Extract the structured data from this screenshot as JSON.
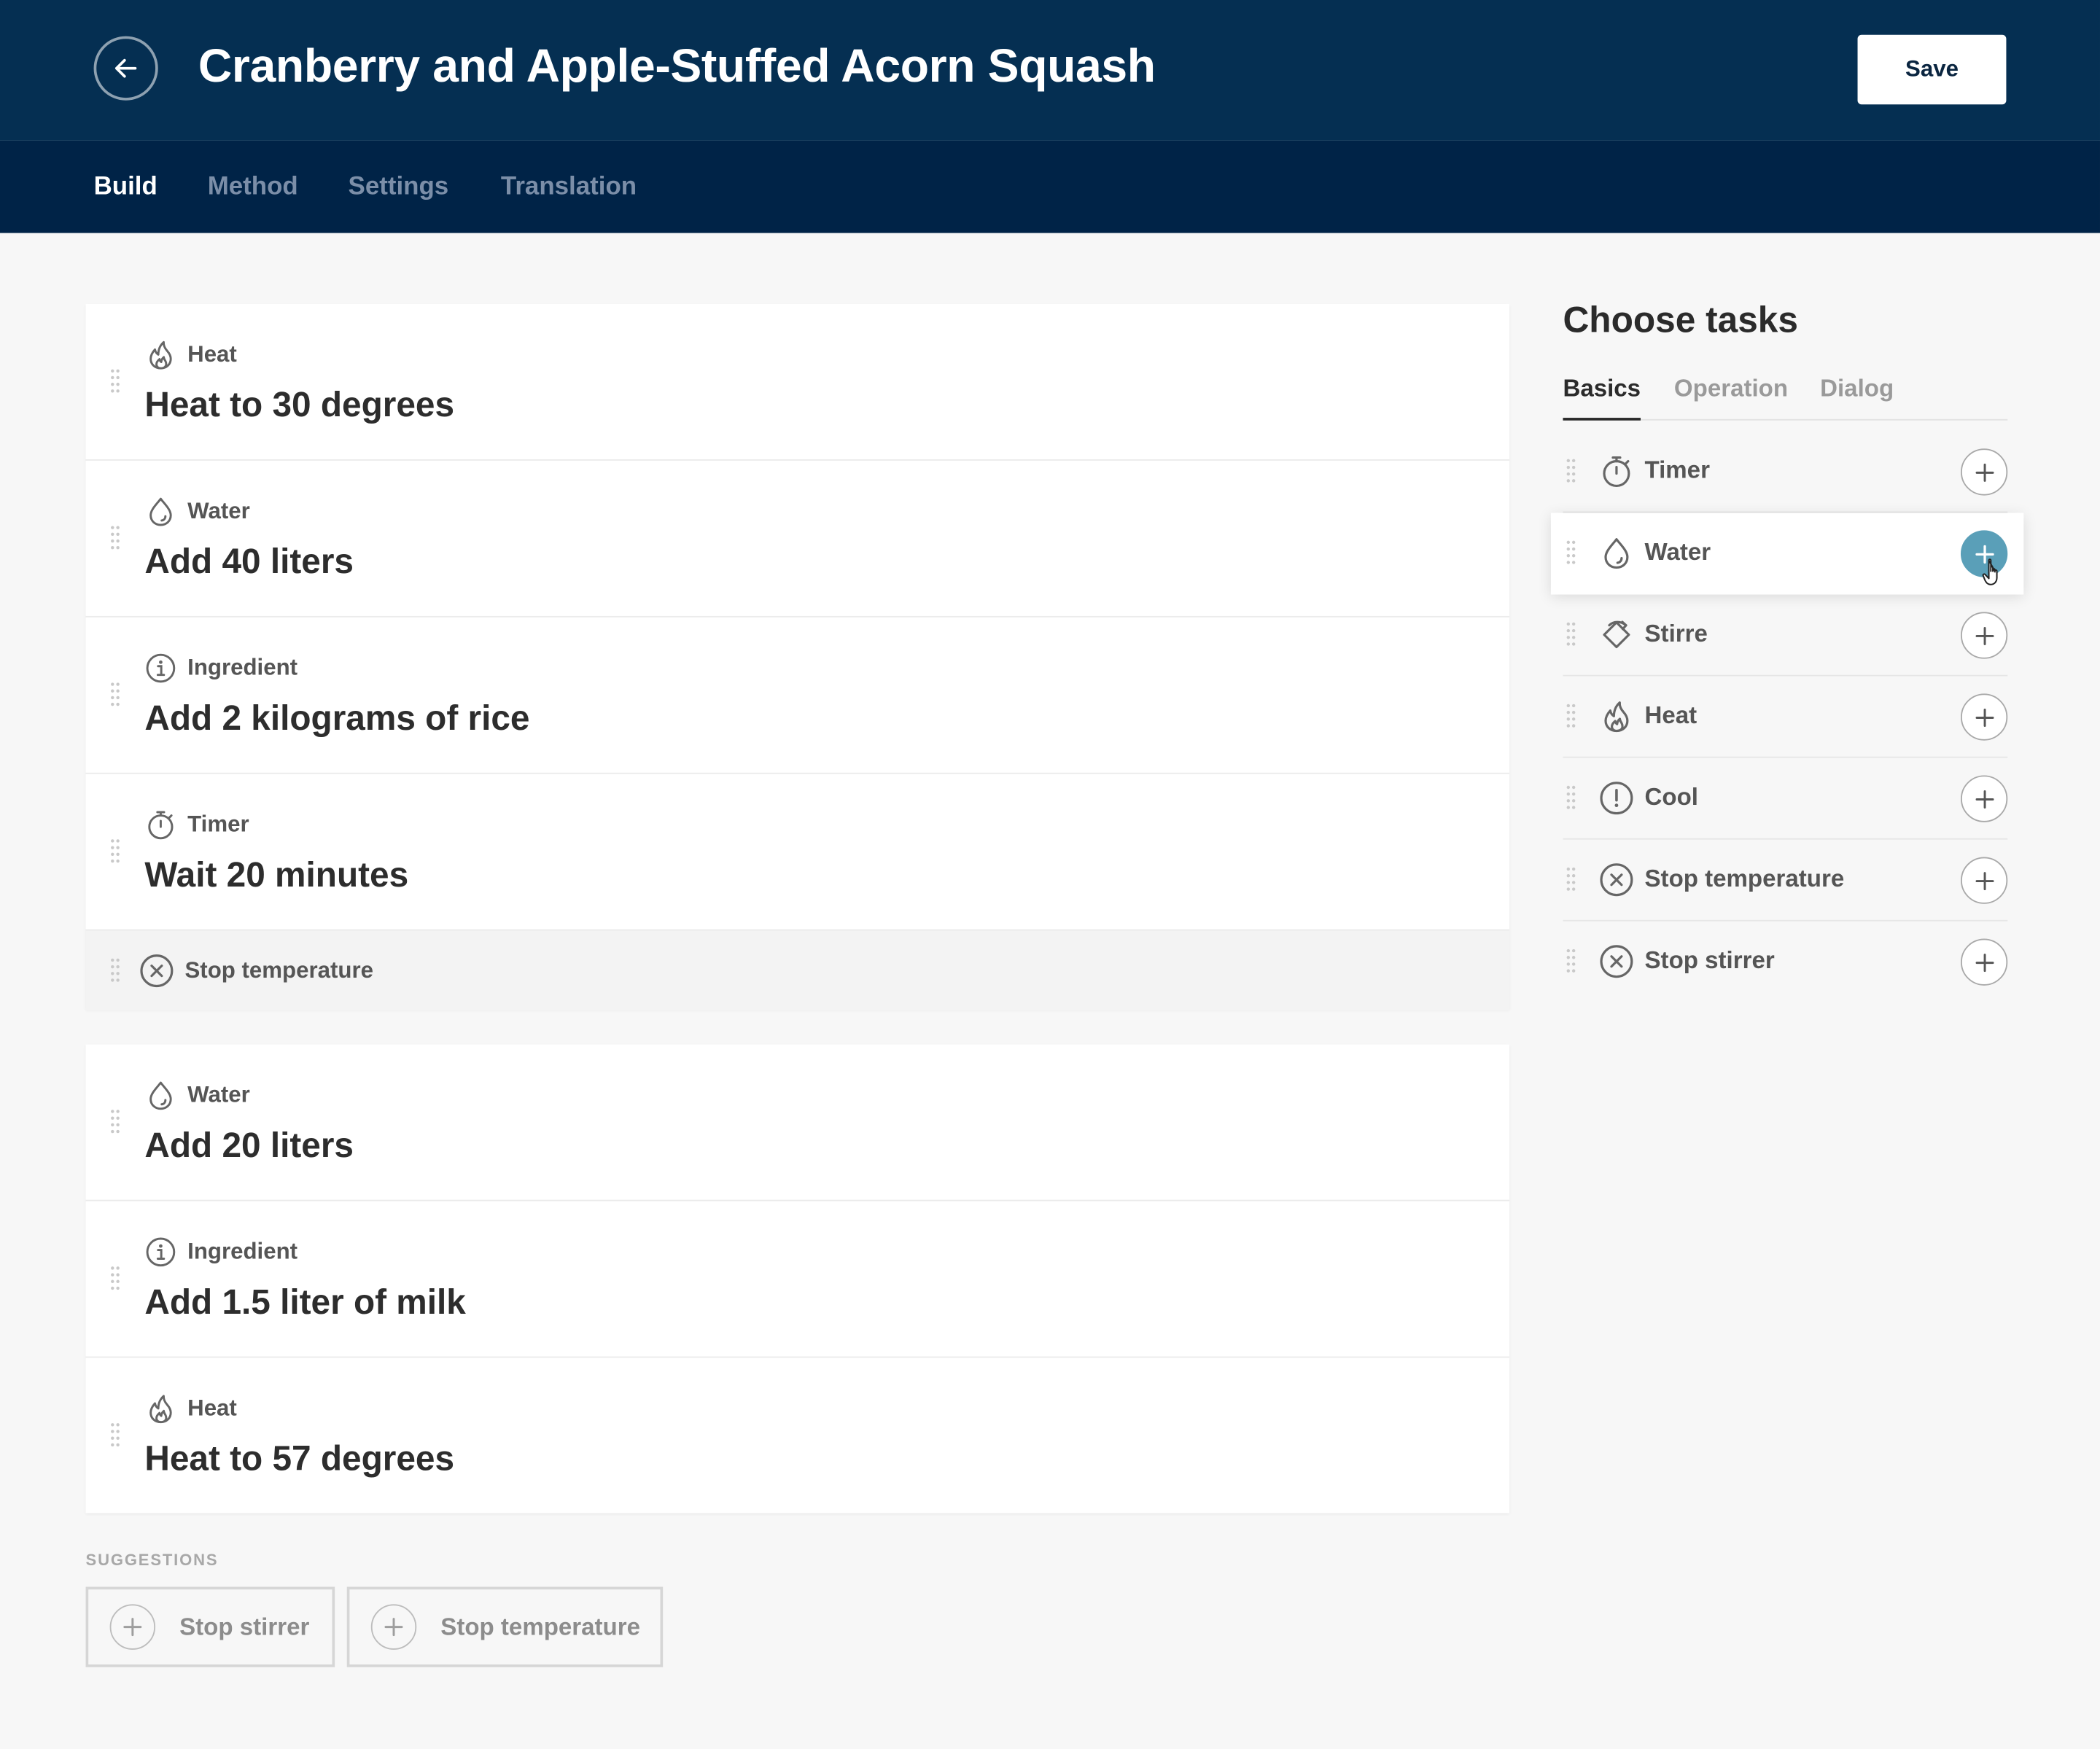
{
  "header": {
    "title": "Cranberry and Apple-Stuffed Acorn Squash",
    "save_label": "Save",
    "back_icon": "arrow-left-icon",
    "background": "#052f52"
  },
  "tabs": [
    {
      "label": "Build",
      "active": true
    },
    {
      "label": "Method",
      "active": false
    },
    {
      "label": "Settings",
      "active": false
    },
    {
      "label": "Translation",
      "active": false
    }
  ],
  "groups": [
    {
      "steps": [
        {
          "type": "Heat",
          "icon": "flame-icon",
          "text": "Heat to 30 degrees"
        },
        {
          "type": "Water",
          "icon": "drop-icon",
          "text": "Add 40 liters"
        },
        {
          "type": "Ingredient",
          "icon": "info-icon",
          "text": "Add 2 kilograms of rice"
        },
        {
          "type": "Timer",
          "icon": "timer-icon",
          "text": "Wait 20 minutes"
        }
      ],
      "substep": {
        "type": "Stop temperature",
        "icon": "x-circle-icon"
      }
    },
    {
      "steps": [
        {
          "type": "Water",
          "icon": "drop-icon",
          "text": "Add 20 liters"
        },
        {
          "type": "Ingredient",
          "icon": "info-icon",
          "text": "Add 1.5 liter of milk"
        },
        {
          "type": "Heat",
          "icon": "flame-icon",
          "text": "Heat to 57 degrees"
        }
      ]
    }
  ],
  "suggestions": {
    "label": "SUGGESTIONS",
    "items": [
      "Stop stirrer",
      "Stop temperature"
    ]
  },
  "sidebar": {
    "title": "Choose tasks",
    "tabs": [
      {
        "label": "Basics",
        "active": true
      },
      {
        "label": "Operation",
        "active": false
      },
      {
        "label": "Dialog",
        "active": false
      }
    ],
    "tasks": [
      {
        "label": "Timer",
        "icon": "timer-icon"
      },
      {
        "label": "Water",
        "icon": "drop-icon",
        "hovered": true
      },
      {
        "label": "Stirre",
        "icon": "stir-icon"
      },
      {
        "label": "Heat",
        "icon": "flame-icon"
      },
      {
        "label": "Cool",
        "icon": "alert-circle-icon"
      },
      {
        "label": "Stop temperature",
        "icon": "x-circle-icon"
      },
      {
        "label": "Stop stirrer",
        "icon": "x-circle-icon"
      }
    ],
    "accent": "#5a9fb8"
  }
}
